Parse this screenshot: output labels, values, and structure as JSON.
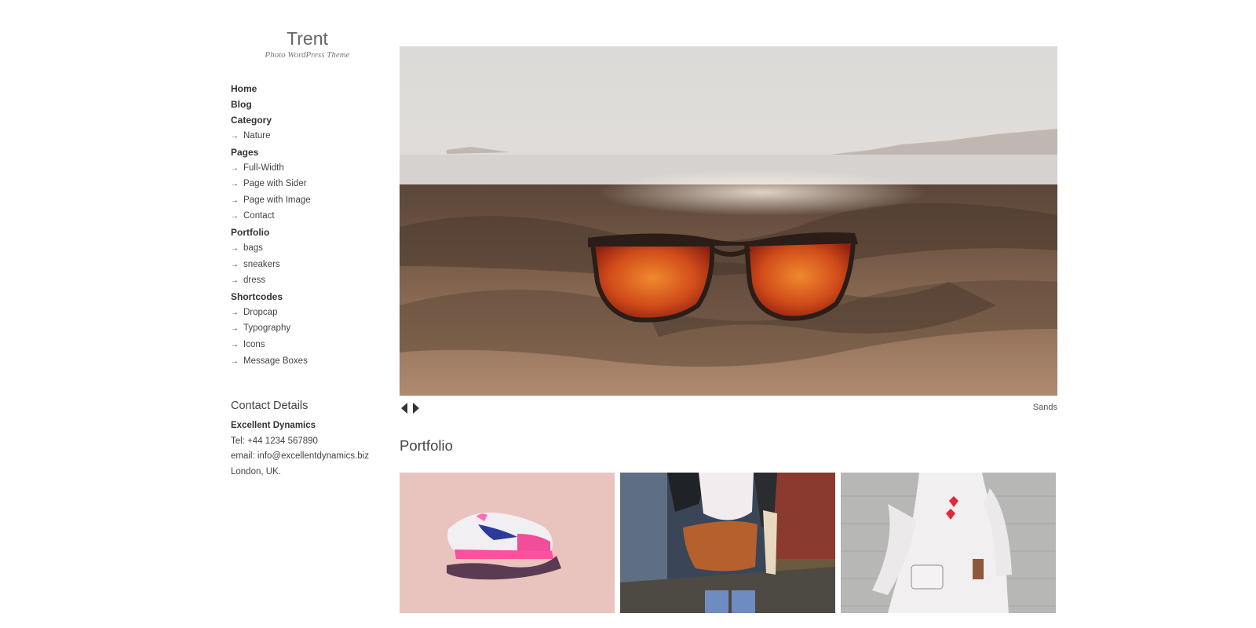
{
  "site": {
    "title": "Trent",
    "tagline": "Photo WordPress Theme"
  },
  "nav": {
    "home": "Home",
    "blog": "Blog",
    "category": "Category",
    "category_items": [
      "Nature"
    ],
    "pages": "Pages",
    "pages_items": [
      "Full-Width",
      "Page with Sider",
      "Page with Image",
      "Contact"
    ],
    "portfolio": "Portfolio",
    "portfolio_items": [
      "bags",
      "sneakers",
      "dress"
    ],
    "shortcodes": "Shortcodes",
    "shortcodes_items": [
      "Dropcap",
      "Typography",
      "Icons",
      "Message Boxes"
    ],
    "arrow_glyph": "→"
  },
  "contact": {
    "heading": "Contact Details",
    "company": "Excellent Dynamics",
    "tel": "Tel: +44 1234 567890",
    "email": "email: info@excellentdynamics.biz",
    "location": "London, UK."
  },
  "slider": {
    "caption": "Sands",
    "prev_icon": "triangle-left-icon",
    "next_icon": "triangle-right-icon"
  },
  "portfolio": {
    "heading": "Portfolio"
  },
  "colors": {
    "text": "#444444",
    "title": "#666666",
    "lens": "#d9531e",
    "sand": "#8a6a52",
    "thumb1_bg": "#e8c3bd",
    "thumb3_bg": "#b9bab8"
  }
}
